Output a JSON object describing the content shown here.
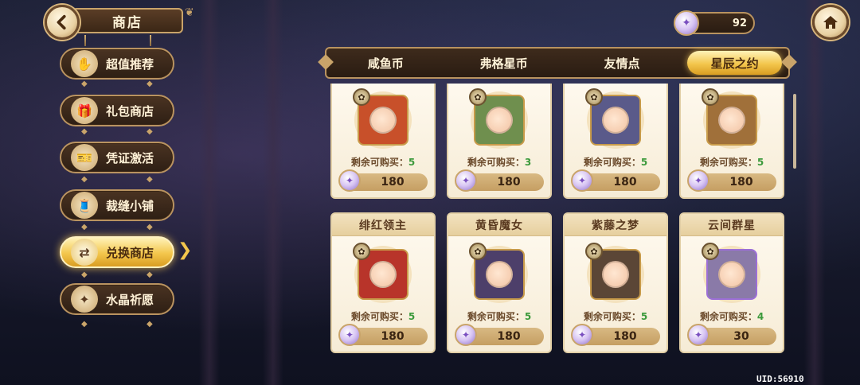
{
  "header": {
    "title": "商店",
    "back_icon": "back-arrow-icon"
  },
  "sidebar": {
    "items": [
      {
        "label": "超值推荐",
        "icon": "hand-icon",
        "glyph": "✋",
        "active": false
      },
      {
        "label": "礼包商店",
        "icon": "gift-icon",
        "glyph": "🎁",
        "active": false
      },
      {
        "label": "凭证激活",
        "icon": "ticket-icon",
        "glyph": "🎫",
        "active": false
      },
      {
        "label": "裁缝小铺",
        "icon": "sewing-icon",
        "glyph": "🧵",
        "active": false
      },
      {
        "label": "兑换商店",
        "icon": "exchange-icon",
        "glyph": "⇄",
        "active": true
      },
      {
        "label": "水晶祈愿",
        "icon": "crystal-icon",
        "glyph": "✦",
        "active": false
      }
    ]
  },
  "currency": {
    "amount": "92",
    "icon": "star-gem-icon"
  },
  "tabs": [
    {
      "label": "咸鱼币",
      "active": false
    },
    {
      "label": "弗格星币",
      "active": false
    },
    {
      "label": "友情点",
      "active": false
    },
    {
      "label": "星辰之约",
      "active": true
    }
  ],
  "items": [
    {
      "title": "",
      "remain_label": "剩余可购买：",
      "remain": "5",
      "price": "180",
      "portrait_color": "#c8502a",
      "frame": "#c89b4a"
    },
    {
      "title": "",
      "remain_label": "剩余可购买：",
      "remain": "3",
      "price": "180",
      "portrait_color": "#6f8f4e",
      "frame": "#c89b4a"
    },
    {
      "title": "",
      "remain_label": "剩余可购买：",
      "remain": "5",
      "price": "180",
      "portrait_color": "#5a5a8a",
      "frame": "#c89b4a"
    },
    {
      "title": "",
      "remain_label": "剩余可购买：",
      "remain": "5",
      "price": "180",
      "portrait_color": "#a0703a",
      "frame": "#c89b4a"
    },
    {
      "title": "绯红领主",
      "remain_label": "剩余可购买：",
      "remain": "5",
      "price": "180",
      "portrait_color": "#b8342a",
      "frame": "#c89b4a"
    },
    {
      "title": "黄昏魔女",
      "remain_label": "剩余可购买：",
      "remain": "5",
      "price": "180",
      "portrait_color": "#4d3f6a",
      "frame": "#c89b4a"
    },
    {
      "title": "紫藤之梦",
      "remain_label": "剩余可购买：",
      "remain": "5",
      "price": "180",
      "portrait_color": "#5b4636",
      "frame": "#c89b4a"
    },
    {
      "title": "云间群星",
      "remain_label": "剩余可购买：",
      "remain": "4",
      "price": "30",
      "portrait_color": "#8a7aa8",
      "frame": "#9c6fd6"
    }
  ],
  "uid": "UID:56910"
}
